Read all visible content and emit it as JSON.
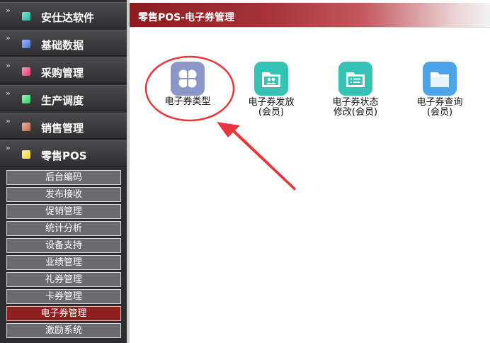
{
  "sidebar": {
    "items": [
      {
        "label": "安仕达软件",
        "icon": "teal-square-icon",
        "color": "#2bb3a3",
        "expanded": false
      },
      {
        "label": "基础数据",
        "icon": "blue-square-icon",
        "color": "#4a74d8",
        "expanded": false
      },
      {
        "label": "采购管理",
        "icon": "pink-square-icon",
        "color": "#e43a6b",
        "expanded": false
      },
      {
        "label": "生产调度",
        "icon": "green-square-icon",
        "color": "#2fd062",
        "expanded": false
      },
      {
        "label": "销售管理",
        "icon": "brown-square-icon",
        "color": "#c26a4e",
        "expanded": false
      },
      {
        "label": "零售POS",
        "icon": "yellow-square-icon",
        "color": "#f2d23a",
        "expanded": true
      }
    ],
    "subitems": [
      {
        "label": "后台编码",
        "active": false
      },
      {
        "label": "发布接收",
        "active": false
      },
      {
        "label": "促销管理",
        "active": false
      },
      {
        "label": "统计分析",
        "active": false
      },
      {
        "label": "设备支持",
        "active": false
      },
      {
        "label": "业绩管理",
        "active": false
      },
      {
        "label": "礼券管理",
        "active": false
      },
      {
        "label": "卡券管理",
        "active": false
      },
      {
        "label": "电子券管理",
        "active": true
      },
      {
        "label": "激励系统",
        "active": false
      }
    ]
  },
  "header": {
    "title": "零售POS-电子券管理"
  },
  "tiles": [
    {
      "line1": "电子券类型",
      "line2": "",
      "icon": "grid-icon",
      "color": "#8b97c6"
    },
    {
      "line1": "电子券发放",
      "line2": "(会员)",
      "icon": "folder-people-icon",
      "color": "#36c2b4"
    },
    {
      "line1": "电子券状态",
      "line2": "修改(会员)",
      "icon": "folder-list-icon",
      "color": "#36c2b4"
    },
    {
      "line1": "电子券查询",
      "line2": "(会员)",
      "icon": "folder-icon",
      "color": "#4ea4e8"
    }
  ],
  "annotation": {
    "color": "#e8373c"
  }
}
